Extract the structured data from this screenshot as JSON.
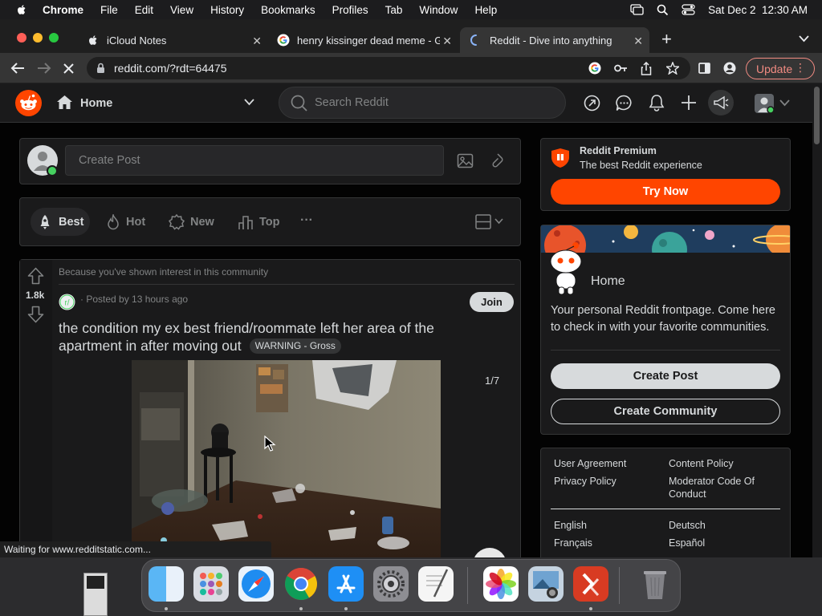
{
  "menubar": {
    "app": "Chrome",
    "items": [
      "File",
      "Edit",
      "View",
      "History",
      "Bookmarks",
      "Profiles",
      "Tab",
      "Window",
      "Help"
    ],
    "datetime": "Sat Dec 2  12:30 AM"
  },
  "tabs": [
    {
      "label": "iCloud Notes",
      "icon": "apple-icon"
    },
    {
      "label": "henry kissinger dead meme - G",
      "icon": "google-icon"
    },
    {
      "label": "Reddit - Dive into anything",
      "icon": "loading-spinner-icon",
      "active": true
    }
  ],
  "toolbar": {
    "url": "reddit.com/?rdt=64475",
    "update_label": "Update"
  },
  "reddit_header": {
    "home_label": "Home",
    "search_placeholder": "Search Reddit"
  },
  "create_post": {
    "placeholder": "Create Post"
  },
  "sort": {
    "items": [
      "Best",
      "Hot",
      "New",
      "Top"
    ],
    "more": "···"
  },
  "post": {
    "context": "Because you've shown interest in this community",
    "votes": "1.8k",
    "posted": "· Posted by 13 hours ago",
    "join_label": "Join",
    "title_line1": "the condition my ex best friend/roommate left her area of the",
    "title_line2": "apartment in after moving out",
    "flair": "WARNING - Gross",
    "gallery_counter": "1/7"
  },
  "premium": {
    "title": "Reddit Premium",
    "subtitle": "The best Reddit experience",
    "cta": "Try Now"
  },
  "home_card": {
    "title": "Home",
    "description_line1": "Your personal Reddit frontpage. Come here",
    "description_line2": "to check in with your favorite communities.",
    "create_post": "Create Post",
    "create_community": "Create Community"
  },
  "footer_links": {
    "user_agreement": "User Agreement",
    "content_policy": "Content Policy",
    "privacy_policy": "Privacy Policy",
    "moderator_code_1": "Moderator Code Of",
    "moderator_code_2": "Conduct",
    "english": "English",
    "deutsch": "Deutsch",
    "francais": "Français",
    "espanol": "Español"
  },
  "status_bar": "Waiting for www.redditstatic.com...",
  "colors": {
    "reddit_orange": "#ff4500",
    "reddit_card": "#1a1a1b",
    "reddit_bg": "#030303",
    "update_red": "#f28b82"
  }
}
